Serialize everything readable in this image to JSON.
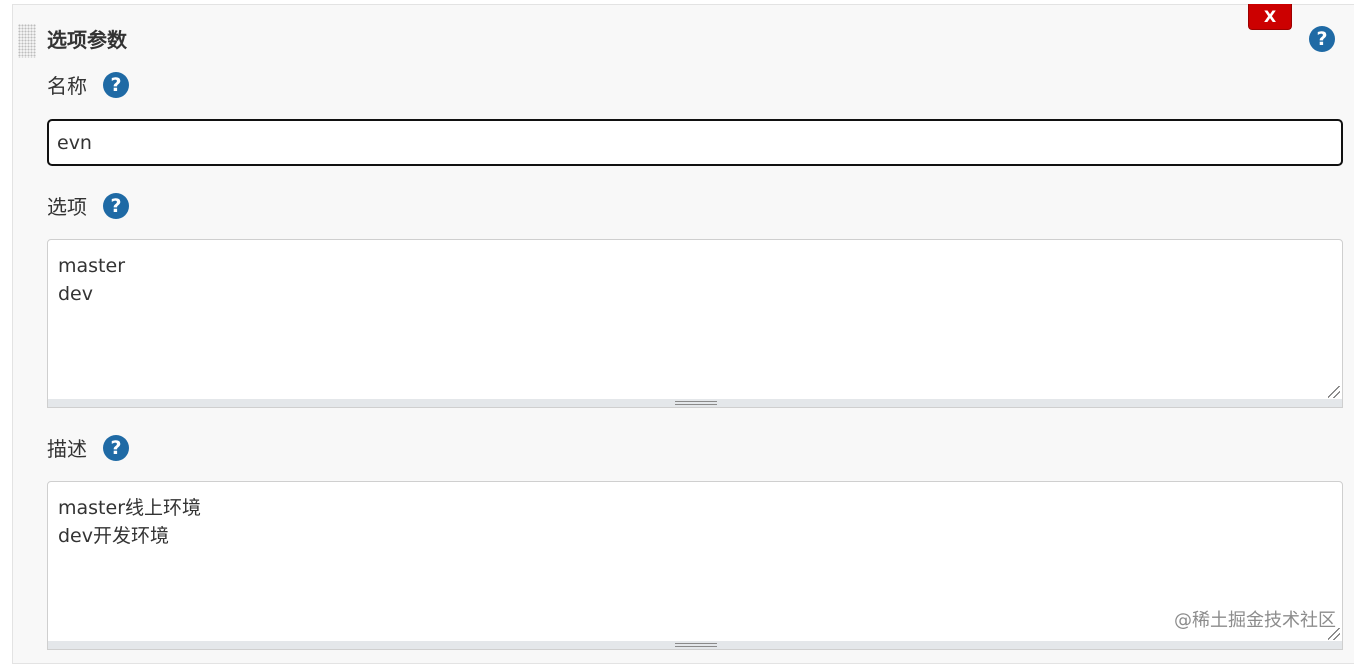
{
  "section": {
    "title": "选项参数",
    "close_label": "X",
    "help_glyph": "?"
  },
  "name_field": {
    "label": "名称",
    "value": "evn"
  },
  "choices_field": {
    "label": "选项",
    "lines": [
      "master",
      "dev"
    ]
  },
  "description_field": {
    "label": "描述",
    "lines": [
      "master线上环境",
      "dev开发环境"
    ]
  },
  "watermark": "@稀土掘金技术社区",
  "colors": {
    "close_button": "#cc0000",
    "help_icon": "#1f6aa5",
    "panel_background": "#f8f8f8"
  }
}
